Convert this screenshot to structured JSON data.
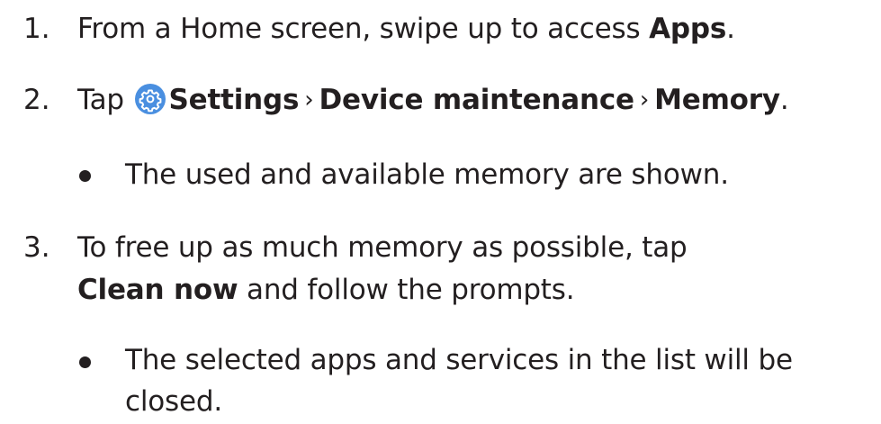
{
  "steps": [
    {
      "number": "1.",
      "text_pre": "From a Home screen, swipe up to access ",
      "bold": "Apps",
      "text_post": "."
    },
    {
      "number": "2.",
      "text_pre": "Tap ",
      "icon": "settings-gear-icon",
      "bold_1": "Settings",
      "separator_1": "›",
      "bold_2": "Device maintenance",
      "separator_2": "›",
      "bold_3": "Memory",
      "text_post": ".",
      "bullet": "The used and available memory are shown."
    },
    {
      "number": "3.",
      "line1": "To free up as much memory as possible, tap",
      "bold": "Clean now",
      "line2_post": " and follow the prompts.",
      "bullet_line1": "The selected apps and services in the list will be",
      "bullet_line2": "closed."
    }
  ],
  "colors": {
    "text": "#231f20",
    "icon_bg": "#4a8fe0",
    "icon_fg": "#ffffff"
  }
}
